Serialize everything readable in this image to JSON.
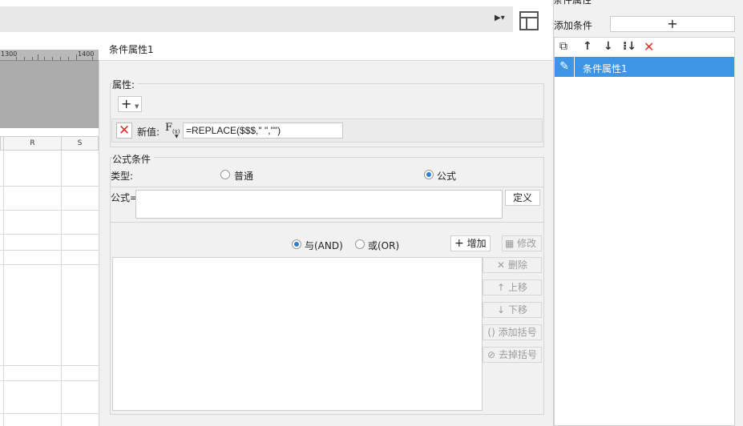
{
  "dialog": {
    "title": "条件属性1",
    "properties_label": "属性:",
    "add_symbol": "+",
    "new_value_label": "新值:",
    "fx_label": "F(x)",
    "formula_value": "=REPLACE($$$,\" \",\"\")",
    "formula_condition_label": "公式条件",
    "type_label": "类型:",
    "type_options": [
      "普通",
      "公式"
    ],
    "type_selected": "公式",
    "formula_label": "公式=",
    "define_button": "定义",
    "logic_and": "与(AND)",
    "logic_or": "或(OR)",
    "logic_selected": "与(AND)",
    "add_button": "增加",
    "modify_button": "修改",
    "delete_button": "删除",
    "move_up_button": "上移",
    "move_down_button": "下移",
    "add_bracket_button": "添加括号",
    "remove_bracket_button": "去掉括号"
  },
  "sheet": {
    "ruler_labels": [
      "1300",
      "1400"
    ],
    "column_headers": [
      "R",
      "S"
    ]
  },
  "right_panel": {
    "header_title": "条件属性",
    "add_condition_label": "添加条件",
    "add_symbol": "+",
    "items": [
      "条件属性1"
    ]
  },
  "colors": {
    "accent": "#3c95e6",
    "delete_red": "#e0302a",
    "radio_blue": "#2d7fd1"
  }
}
